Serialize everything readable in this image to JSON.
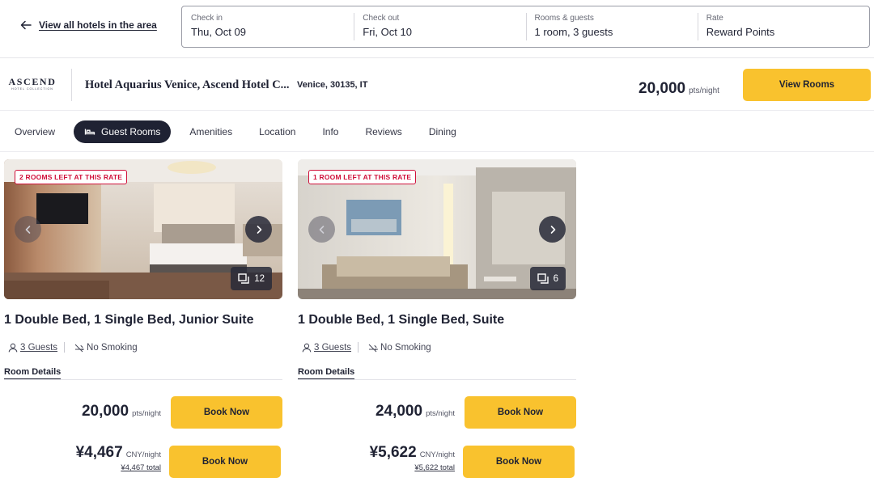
{
  "top_bar": {
    "back_label": "View all hotels in the area",
    "search": [
      {
        "label": "Check in",
        "value": "Thu, Oct 09"
      },
      {
        "label": "Check out",
        "value": "Fri, Oct 10"
      },
      {
        "label": "Rooms & guests",
        "value": "1 room, 3 guests"
      },
      {
        "label": "Rate",
        "value": "Reward Points"
      }
    ]
  },
  "hotel": {
    "brand": "ASCEND",
    "brand_sub": "HOTEL COLLECTION",
    "name": "Hotel Aquarius Venice, Ascend Hotel C...",
    "location": "Venice, 30135, IT",
    "price": "20,000",
    "price_unit": "pts/night",
    "cta": "View Rooms"
  },
  "tabs": [
    {
      "label": "Overview",
      "active": false
    },
    {
      "label": "Guest Rooms",
      "active": true,
      "icon": "bed-icon"
    },
    {
      "label": "Amenities",
      "active": false
    },
    {
      "label": "Location",
      "active": false
    },
    {
      "label": "Info",
      "active": false
    },
    {
      "label": "Reviews",
      "active": false
    },
    {
      "label": "Dining",
      "active": false
    }
  ],
  "rooms": [
    {
      "badge": "2 ROOMS LEFT AT THIS RATE",
      "photo_count": "12",
      "title": "1 Double Bed, 1 Single Bed, Junior Suite",
      "guests": "3 Guests",
      "smoking": "No Smoking",
      "details_label": "Room Details",
      "points_price": "20,000",
      "points_unit": "pts/night",
      "cash_price": "¥4,467",
      "cash_unit": "CNY/night",
      "cash_total": "¥4,467 total",
      "book_label": "Book Now"
    },
    {
      "badge": "1 ROOM LEFT AT THIS RATE",
      "photo_count": "6",
      "title": "1 Double Bed, 1 Single Bed, Suite",
      "guests": "3 Guests",
      "smoking": "No Smoking",
      "details_label": "Room Details",
      "points_price": "24,000",
      "points_unit": "pts/night",
      "cash_price": "¥5,622",
      "cash_unit": "CNY/night",
      "cash_total": "¥5,622 total",
      "book_label": "Book Now"
    }
  ],
  "colors": {
    "accent": "#f9c22e",
    "dark": "#1f2233",
    "badge_red": "#d0103a"
  }
}
